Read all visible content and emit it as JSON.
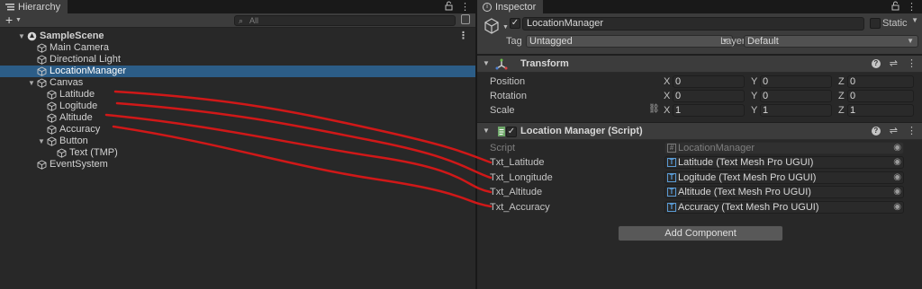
{
  "hierarchy": {
    "tab_title": "Hierarchy",
    "search_placeholder": "All",
    "add_label": "+",
    "items": [
      {
        "label": "SampleScene",
        "depth": 0,
        "expanded": true,
        "scene": true
      },
      {
        "label": "Main Camera",
        "depth": 1
      },
      {
        "label": "Directional Light",
        "depth": 1
      },
      {
        "label": "LocationManager",
        "depth": 1,
        "selected": true
      },
      {
        "label": "Canvas",
        "depth": 1,
        "expanded": true
      },
      {
        "label": "Latitude",
        "depth": 2
      },
      {
        "label": "Logitude",
        "depth": 2
      },
      {
        "label": "Altitude",
        "depth": 2
      },
      {
        "label": "Accuracy",
        "depth": 2
      },
      {
        "label": "Button",
        "depth": 2,
        "expanded": true
      },
      {
        "label": "Text (TMP)",
        "depth": 3
      },
      {
        "label": "EventSystem",
        "depth": 1
      }
    ]
  },
  "inspector": {
    "tab_title": "Inspector",
    "object_name": "LocationManager",
    "static_label": "Static",
    "tag_label": "Tag",
    "tag_value": "Untagged",
    "layer_label": "Layer",
    "layer_value": "Default",
    "transform": {
      "title": "Transform",
      "position_label": "Position",
      "rotation_label": "Rotation",
      "scale_label": "Scale",
      "position": [
        "0",
        "0",
        "0"
      ],
      "rotation": [
        "0",
        "0",
        "0"
      ],
      "scale": [
        "1",
        "1",
        "1"
      ],
      "axes": [
        "X",
        "Y",
        "Z"
      ]
    },
    "script_component": {
      "title": "Location Manager (Script)",
      "script_label": "Script",
      "script_value": "LocationManager",
      "fields": [
        {
          "label": "Txt_Latitude",
          "value": "Latitude (Text Mesh Pro UGUI)"
        },
        {
          "label": "Txt_Longitude",
          "value": "Logitude (Text Mesh Pro UGUI)"
        },
        {
          "label": "Txt_Altitude",
          "value": "Altitude (Text Mesh Pro UGUI)"
        },
        {
          "label": "Txt_Accuracy",
          "value": "Accuracy (Text Mesh Pro UGUI)"
        }
      ]
    },
    "add_component_label": "Add Component"
  },
  "colors": {
    "selection": "#2c5d87",
    "annotation": "#d01818",
    "panel_bg": "#282828",
    "header_bg": "#3c3c3c"
  }
}
